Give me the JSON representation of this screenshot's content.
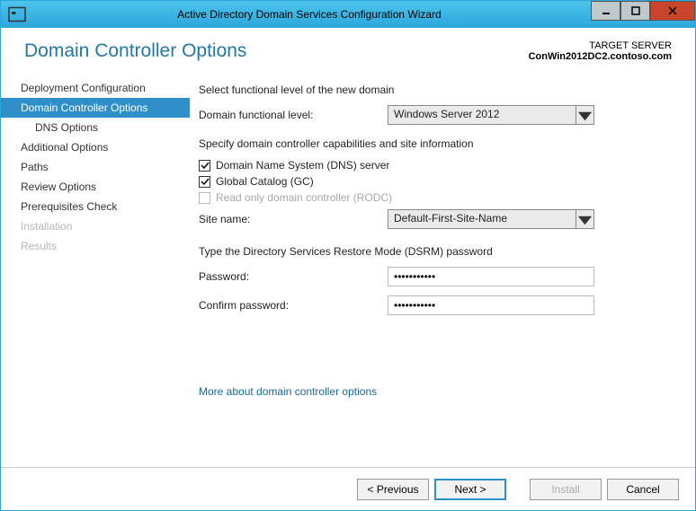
{
  "window": {
    "title": "Active Directory Domain Services Configuration Wizard"
  },
  "header": {
    "pageTitle": "Domain Controller Options",
    "targetLabel": "TARGET SERVER",
    "targetServer": "ConWin2012DC2.contoso.com"
  },
  "sidebar": {
    "items": [
      {
        "label": "Deployment Configuration"
      },
      {
        "label": "Domain Controller Options"
      },
      {
        "label": "DNS Options"
      },
      {
        "label": "Additional Options"
      },
      {
        "label": "Paths"
      },
      {
        "label": "Review Options"
      },
      {
        "label": "Prerequisites Check"
      },
      {
        "label": "Installation"
      },
      {
        "label": "Results"
      }
    ]
  },
  "form": {
    "section1": "Select functional level of the new domain",
    "domainFuncLabel": "Domain functional level:",
    "domainFuncValue": "Windows Server 2012",
    "section2": "Specify domain controller capabilities and site information",
    "dnsLabel": "Domain Name System (DNS) server",
    "gcLabel": "Global Catalog (GC)",
    "rodcLabel": "Read only domain controller (RODC)",
    "siteNameLabel": "Site name:",
    "siteNameValue": "Default-First-Site-Name",
    "section3": "Type the Directory Services Restore Mode (DSRM) password",
    "pwdLabel": "Password:",
    "pwdValue": "•••••••••••",
    "confirmLabel": "Confirm password:",
    "confirmValue": "•••••••••••",
    "link": "More about domain controller options"
  },
  "footer": {
    "prev": "< Previous",
    "next": "Next >",
    "install": "Install",
    "cancel": "Cancel"
  }
}
